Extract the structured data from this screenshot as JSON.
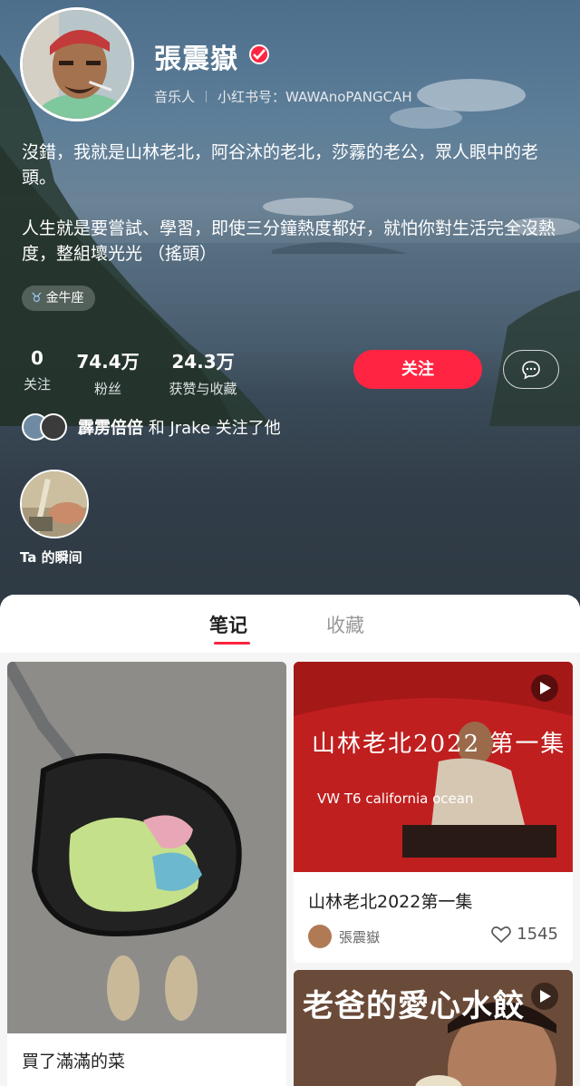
{
  "profile": {
    "name": "張震嶽",
    "role": "音乐人",
    "id_label": "小红书号：WAWAnoPANGCAH",
    "bio": "沒錯，我就是山林老北，阿谷沐的老北，莎霧的老公，眾人眼中的老頭。\n\n人生就是要嘗試、學習，即使三分鐘熱度都好，就怕你對生活完全沒熱度，整組壞光光 （搖頭）",
    "tag": "金牛座",
    "tag_icon": "taurus-icon"
  },
  "stats": [
    {
      "value": "0",
      "label": "关注"
    },
    {
      "value": "74.4万",
      "label": "粉丝"
    },
    {
      "value": "24.3万",
      "label": "获赞与收藏"
    }
  ],
  "actions": {
    "follow": "关注",
    "message_icon": "chat-bubble-icon"
  },
  "mutual": {
    "names": "霹雳倍倍",
    "rest": " 和 Jrake 关注了他"
  },
  "moments": {
    "label": "Ta 的瞬间"
  },
  "tabs": [
    {
      "label": "笔记",
      "active": true
    },
    {
      "label": "收藏",
      "active": false
    }
  ],
  "notes": [
    {
      "title": "買了滿滿的菜"
    },
    {
      "title": "山林老北2022第一集",
      "overlay_title": "山林老北2022 第一集",
      "overlay_sub": "VW T6 california ocean",
      "author": "張震嶽",
      "likes": "1545",
      "video": true
    },
    {
      "overlay_title": "老爸的愛心水餃",
      "video": true
    }
  ],
  "colors": {
    "accent": "#ff2442",
    "sheet_bg": "#f5f5f5"
  }
}
